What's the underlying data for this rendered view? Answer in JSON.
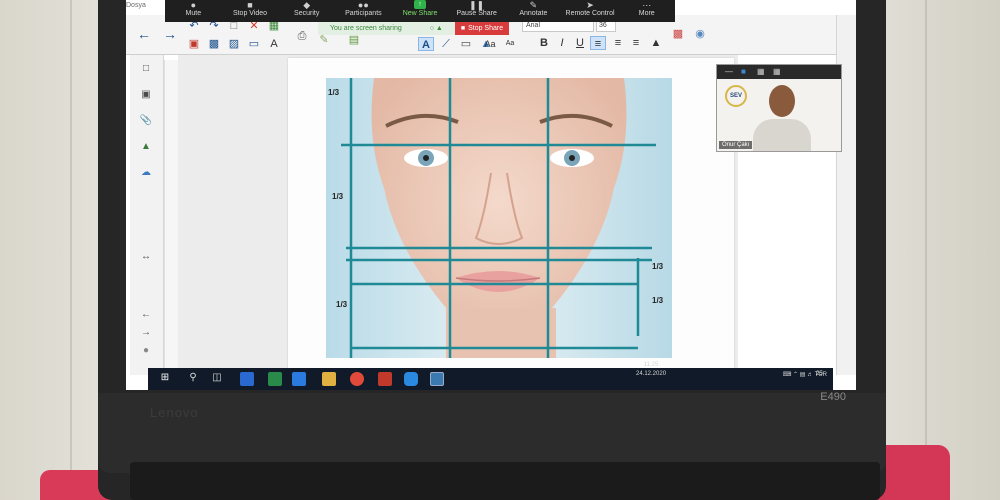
{
  "zoom_controls": {
    "menu_partial": "Dosya",
    "items": [
      {
        "label": "Mute",
        "icon": "microphone-icon"
      },
      {
        "label": "Stop Video",
        "icon": "video-camera-icon"
      },
      {
        "label": "Security",
        "icon": "shield-icon"
      },
      {
        "label": "Participants",
        "icon": "participants-icon"
      },
      {
        "label": "New Share",
        "icon": "share-arrow-icon"
      },
      {
        "label": "Pause Share",
        "icon": "pause-icon"
      },
      {
        "label": "Annotate",
        "icon": "pen-icon"
      },
      {
        "label": "Remote Control",
        "icon": "cursor-icon"
      },
      {
        "label": "More",
        "icon": "ellipsis-icon"
      }
    ],
    "sharing_status": "You are screen sharing",
    "stop_share_label": "Stop Share",
    "accent_green": "#2fb34a",
    "stop_red": "#d83b3b"
  },
  "notebook_toolbar": {
    "font_name": "Arial",
    "font_size": "36",
    "text_style_buttons": [
      "Aa",
      "Aa",
      "B",
      "I",
      "U"
    ],
    "aa_a_label": "A",
    "text_a_label": "A"
  },
  "canvas": {
    "labels_left": [
      "1/3",
      "1/3",
      "1/3"
    ],
    "labels_right": [
      "1/3",
      "1/3"
    ],
    "guide_color": "#1f8a96"
  },
  "video_tile": {
    "participant_name": "Onur Çakı",
    "logo_text": "SEV"
  },
  "taskbar": {
    "language": "TUR",
    "time": "11:25",
    "date": "24.12.2020",
    "notification_count": "25"
  },
  "laptop": {
    "brand": "Lenovo",
    "model": "E490"
  }
}
